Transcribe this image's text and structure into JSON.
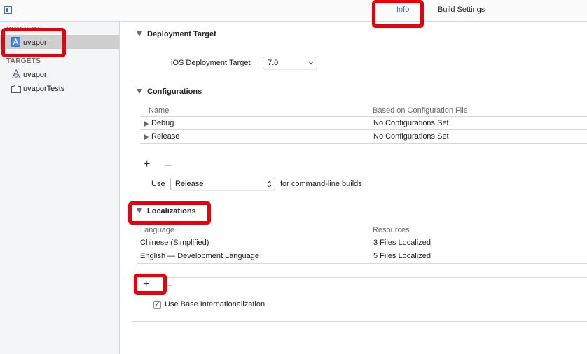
{
  "top_tabs": {
    "info": "Info",
    "build_settings": "Build Settings"
  },
  "sidebar": {
    "project_header": "PROJECT",
    "project_item": "uvapor",
    "targets_header": "TARGETS",
    "targets": [
      {
        "label": "uvapor",
        "icon": "app-target-icon"
      },
      {
        "label": "uvaporTests",
        "icon": "test-bundle-icon"
      }
    ]
  },
  "deployment": {
    "title": "Deployment Target",
    "label": "iOS Deployment Target",
    "value": "7.0"
  },
  "configurations": {
    "title": "Configurations",
    "col_name": "Name",
    "col_file": "Based on Configuration File",
    "rows": [
      {
        "name": "Debug",
        "file": "No Configurations Set"
      },
      {
        "name": "Release",
        "file": "No Configurations Set"
      }
    ],
    "use_label": "Use",
    "use_value": "Release",
    "use_suffix": "for command-line builds"
  },
  "localizations": {
    "title": "Localizations",
    "col_language": "Language",
    "col_resources": "Resources",
    "rows": [
      {
        "language": "Chinese (Simplified)",
        "resources": "3 Files Localized"
      },
      {
        "language": "English — Development Language",
        "resources": "5 Files Localized"
      }
    ],
    "base_intl_label": "Use Base Internationalization",
    "base_intl_checked": true
  },
  "colors": {
    "accent": "#2f6fd6",
    "highlight": "#e8000b",
    "selection": "#cfcfcf"
  }
}
